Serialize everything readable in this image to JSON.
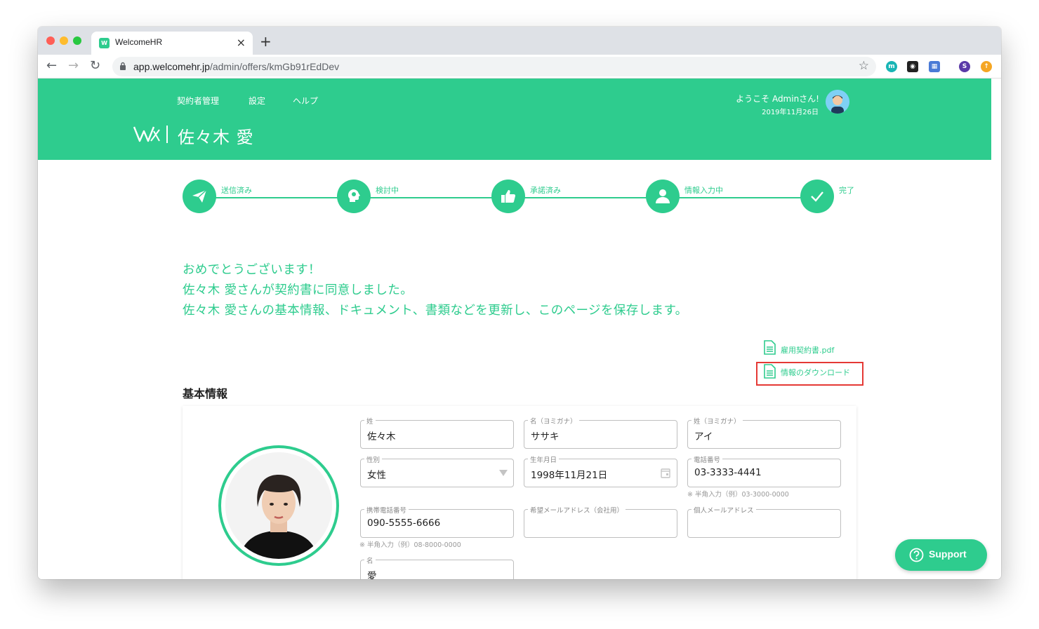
{
  "browser": {
    "tab_title": "WelcomeHR",
    "tab_close": "×",
    "new_tab": "+",
    "url_host": "app.welcomehr.jp",
    "url_path": "/admin/offers/kmGb91rEdDev",
    "ext_s_letter": "S"
  },
  "header": {
    "nav": [
      "契約者管理",
      "設定",
      "ヘルプ"
    ],
    "welcome": "ようこそ Adminさん!",
    "date": "2019年11月26日",
    "person_name": "佐々木 愛"
  },
  "steps": [
    {
      "label": "送信済み",
      "icon": "paper-plane-icon"
    },
    {
      "label": "検討中",
      "icon": "thinking-head-icon"
    },
    {
      "label": "承諾済み",
      "icon": "thumbs-up-icon"
    },
    {
      "label": "情報入力中",
      "icon": "user-icon"
    },
    {
      "label": "完了",
      "icon": "check-icon"
    }
  ],
  "message": {
    "line1": "おめでとうございます！",
    "line2": "佐々木 愛さんが契約書に同意しました。",
    "line3": "佐々木 愛さんの基本情報、ドキュメント、書類などを更新し、このページを保存します。"
  },
  "files": {
    "contract": "雇用契約書.pdf",
    "download": "情報のダウンロード"
  },
  "section": {
    "title": "基本情報"
  },
  "form": {
    "last_name": {
      "label": "姓",
      "value": "佐々木"
    },
    "first_kana": {
      "label": "名（ヨミガナ）",
      "value": "ササキ"
    },
    "last_kana": {
      "label": "姓（ヨミガナ）",
      "value": "アイ"
    },
    "gender": {
      "label": "性別",
      "value": "女性"
    },
    "birthday": {
      "label": "生年月日",
      "value": "1998年11月21日"
    },
    "phone": {
      "label": "電話番号",
      "value": "03-3333-4441",
      "hint": "※ 半角入力（例）03-3000-0000"
    },
    "mobile": {
      "label": "携帯電話番号",
      "value": "090-5555-6666",
      "hint": "※ 半角入力（例）08-8000-0000"
    },
    "work_email": {
      "label": "希望メールアドレス（会社用）",
      "value": ""
    },
    "personal_email": {
      "label": "個人メールアドレス",
      "value": ""
    },
    "first_name": {
      "label": "名",
      "value": "愛"
    }
  },
  "support": {
    "label": "Support"
  },
  "colors": {
    "brand": "#2ecc8e",
    "highlight": "#e53935"
  }
}
